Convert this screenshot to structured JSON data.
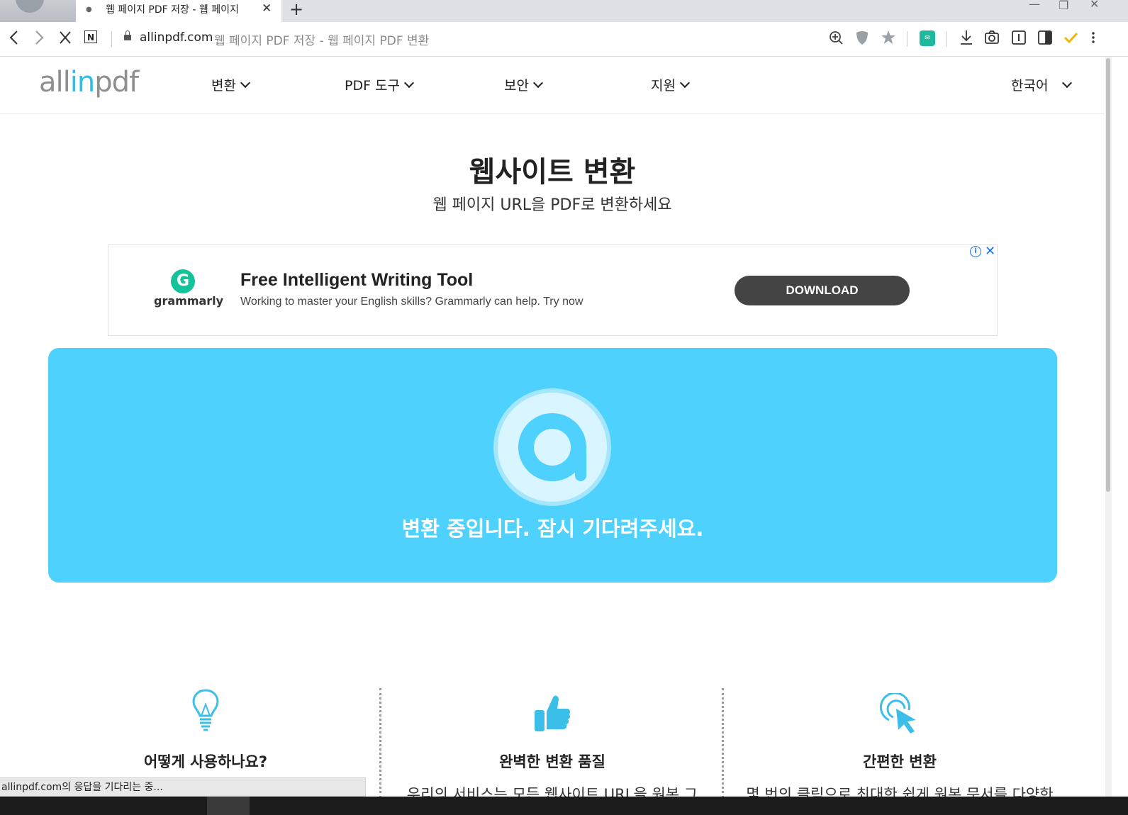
{
  "browser": {
    "tab_title": "웹 페이지 PDF 저장 - 웹 페이지",
    "tab_dot": "●",
    "tab_close": "✕",
    "new_tab": "+",
    "url_host": "allinpdf.com",
    "url_title": "웹 페이지 PDF 저장 - 웹 페이지 PDF 변환",
    "icons": [
      "back-icon",
      "forward-icon",
      "stop-icon",
      "reader-icon",
      "lock-icon",
      "zoom-icon",
      "shield-icon",
      "star-icon",
      "extension-icon",
      "download-icon",
      "camera-icon",
      "sidebar-icon",
      "split-view-icon",
      "check-icon",
      "menu-icon"
    ],
    "win": {
      "minimize": "—",
      "restore": "❐",
      "close": "✕"
    }
  },
  "site": {
    "logo_pre": "all",
    "logo_in": "in",
    "logo_post": "pdf",
    "nav": [
      "변환",
      "PDF 도구",
      "보안",
      "지원"
    ],
    "language": "한국어"
  },
  "hero": {
    "title": "웹사이트 변환",
    "subtitle": "웹 페이지 URL을 PDF로 변환하세요"
  },
  "ad": {
    "brand_letter": "G",
    "brand": "grammarly",
    "headline": "Free Intelligent Writing Tool",
    "body": "Working to master your English skills? Grammarly can help. Try now",
    "button": "DOWNLOAD",
    "info": "i",
    "close": "✕"
  },
  "converter": {
    "message": "변환 중입니다. 잠시 기다려주세요."
  },
  "features": [
    {
      "icon": "lightbulb-icon",
      "title": "어떻게 사용하나요?",
      "desc": ""
    },
    {
      "icon": "thumbs-up-icon",
      "title": "완벽한 변환 품질",
      "desc": "우리의 서비스는 모든 웹사이트 URL을 원본 그"
    },
    {
      "icon": "click-cursor-icon",
      "title": "간편한 변환",
      "desc": "몇 번의 클릭으로 최대한 쉽게 원본 문서를 다양한"
    }
  ],
  "status_bar": "allinpdf.com의 응답을 기다리는 중...",
  "colors": {
    "accent": "#4ed1fc",
    "logo_in": "#29c0ea",
    "ad_button": "#444444",
    "grammarly": "#15c39a"
  }
}
